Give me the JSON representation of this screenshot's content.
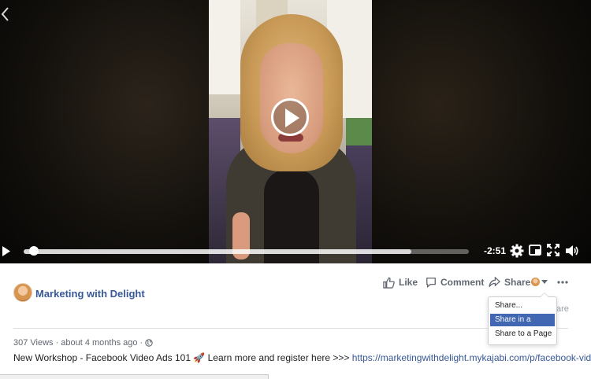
{
  "player": {
    "time_remaining": "-2:51",
    "progress": 0.02,
    "buffered": 0.87
  },
  "post": {
    "page_name": "Marketing with Delight",
    "actions": {
      "like": "Like",
      "comment": "Comment",
      "share": "Share"
    },
    "meta": {
      "views": "307 Views",
      "separator": "·",
      "time_ago": "about 4 months ago",
      "separator2": "·"
    },
    "description": {
      "text": "New Workshop - Facebook Video Ads 101 🚀 Learn more and register here >>> ",
      "link": "https://marketingwithdelight.mykajabi.com/p/facebook-video-..."
    },
    "ghost_text": "are"
  },
  "share_menu": {
    "items": [
      "Share...",
      "Share in a Group",
      "Share to a Page"
    ],
    "selected_index": 1
  },
  "colors": {
    "link": "#385898",
    "menu_highlight": "#4267b2",
    "secondary_text": "#606770"
  },
  "icons": [
    "back-chevron-icon",
    "play-overlay-icon",
    "play-icon",
    "settings-gear-icon",
    "picture-in-picture-icon",
    "fullscreen-icon",
    "volume-icon",
    "like-thumb-icon",
    "comment-bubble-icon",
    "share-arrow-icon",
    "audience-chevron-icon",
    "more-options-icon",
    "globe-icon",
    "rocket-emoji"
  ]
}
